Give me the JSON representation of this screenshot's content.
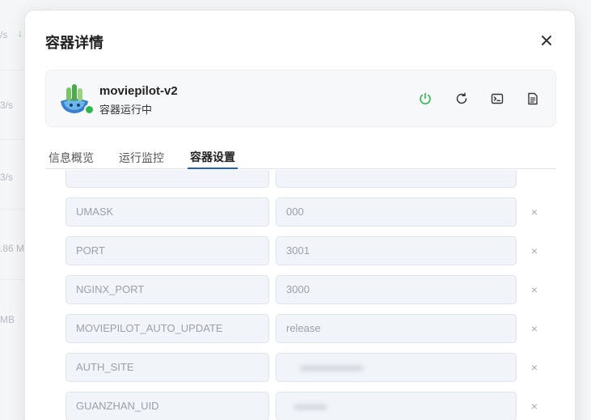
{
  "background": {
    "fragments": [
      "/s",
      "3/s",
      "3/s",
      ".86 M",
      "MB"
    ]
  },
  "modal": {
    "title": "容器详情",
    "close_label": "×"
  },
  "container": {
    "name": "moviepilot-v2",
    "status": "容器运行中",
    "status_color": "#2eb84b"
  },
  "actions": [
    {
      "name": "power-icon",
      "color": "#2eb84b"
    },
    {
      "name": "restart-icon",
      "color": "#333333"
    },
    {
      "name": "terminal-icon",
      "color": "#333333"
    },
    {
      "name": "log-document-icon",
      "color": "#333333"
    }
  ],
  "tabs": [
    {
      "label": "信息概览",
      "active": false
    },
    {
      "label": "运行监控",
      "active": false
    },
    {
      "label": "容器设置",
      "active": true
    }
  ],
  "env_vars": [
    {
      "key": "",
      "value": ""
    },
    {
      "key": "UMASK",
      "value": "000"
    },
    {
      "key": "PORT",
      "value": "3001"
    },
    {
      "key": "NGINX_PORT",
      "value": "3000"
    },
    {
      "key": "MOVIEPILOT_AUTO_UPDATE",
      "value": "release"
    },
    {
      "key": "AUTH_SITE",
      "value": ""
    },
    {
      "key": "GUANZHAN_UID",
      "value": ""
    }
  ],
  "delete_label": "×",
  "colors": {
    "accent": "#1f5fd1",
    "field_bg": "#f1f4f9",
    "field_border": "#dfe4ec"
  }
}
